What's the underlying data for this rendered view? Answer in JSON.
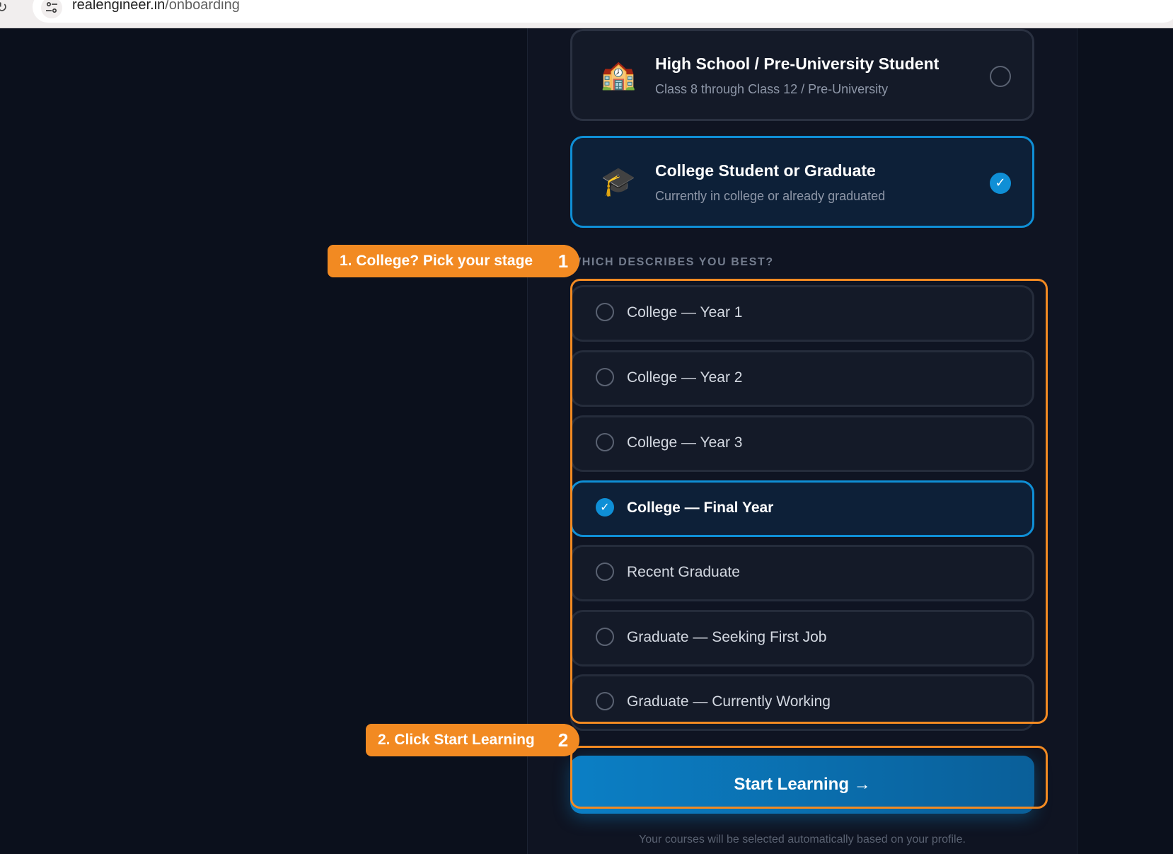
{
  "browser": {
    "reload_glyph": "↻",
    "url_domain": "realengineer.in",
    "url_path": "/onboarding"
  },
  "roles": [
    {
      "emoji": "🏫",
      "title": "High School / Pre-University Student",
      "subtitle": "Class 8 through Class 12 / Pre-University",
      "selected": false
    },
    {
      "emoji": "🎓",
      "title": "College Student or Graduate",
      "subtitle": "Currently in college or already graduated",
      "selected": true,
      "check": "✓"
    }
  ],
  "stage_section": {
    "label": "WHICH DESCRIBES YOU BEST?",
    "options": [
      {
        "label": "College — Year 1",
        "selected": false
      },
      {
        "label": "College — Year 2",
        "selected": false
      },
      {
        "label": "College — Year 3",
        "selected": false
      },
      {
        "label": "College — Final Year",
        "selected": true,
        "check": "✓"
      },
      {
        "label": "Recent Graduate",
        "selected": false
      },
      {
        "label": "Graduate — Seeking First Job",
        "selected": false
      },
      {
        "label": "Graduate — Currently Working",
        "selected": false
      }
    ]
  },
  "start_button": {
    "label": "Start Learning →"
  },
  "footer_note": "Your courses will be selected automatically based on your profile.",
  "annotations": [
    {
      "text": "1. College? Pick your stage",
      "step": "1"
    },
    {
      "text": "2. Click Start Learning",
      "step": "2"
    }
  ],
  "colors": {
    "accent": "#0f8fd6",
    "annotation": "#f28a22",
    "background": "#0b101c",
    "panel": "#0f1422"
  },
  "icons": {
    "reload": "reload-icon",
    "site_info": "site-info-icon",
    "role_high_school": "school-building-icon",
    "role_college": "graduation-cap-icon",
    "checkmark": "checkmark-icon"
  }
}
